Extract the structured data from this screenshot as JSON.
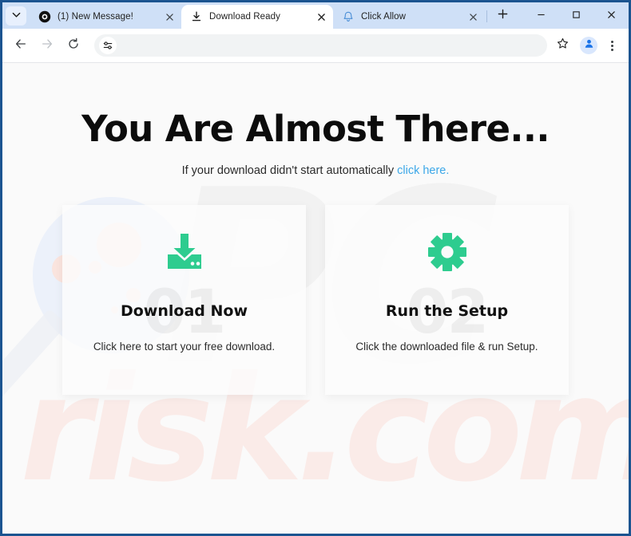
{
  "browser": {
    "tab_search_icon": "chevron-down-icon",
    "tabs": [
      {
        "title": "(1) New Message!",
        "favicon": "black-circle-icon",
        "active": false,
        "close_label": "×"
      },
      {
        "title": "Download Ready",
        "favicon": "download-icon",
        "active": true,
        "close_label": "×"
      },
      {
        "title": "Click Allow",
        "favicon": "bell-icon",
        "active": false,
        "close_label": "×"
      }
    ],
    "new_tab_label": "+",
    "window_controls": {
      "minimize": "–",
      "maximize": "□",
      "close": "×"
    },
    "toolbar": {
      "back_icon": "arrow-left-icon",
      "forward_icon": "arrow-right-icon",
      "reload_icon": "reload-icon",
      "omnibox_icon": "tune-icon",
      "omnibox_value": "",
      "omnibox_placeholder": "",
      "bookmark_icon": "star-icon",
      "profile_icon": "account-avatar-icon",
      "menu_icon": "three-dot-menu-icon"
    }
  },
  "page": {
    "headline": "You Are Almost There...",
    "subline_text": "If your download didn't start automatically ",
    "subline_link": "click here.",
    "watermarks": {
      "brand_primary": "PC",
      "brand_secondary": "risk.com"
    },
    "cards": [
      {
        "number": "01",
        "icon": "download-tray-icon",
        "title": "Download Now",
        "description": "Click here to start your free download."
      },
      {
        "number": "02",
        "icon": "gear-icon",
        "title": "Run the Setup",
        "description": "Click the downloaded file & run Setup."
      }
    ]
  },
  "colors": {
    "accent_green": "#2ecc8f",
    "link_blue": "#3ba7e8",
    "tabstrip_blue": "#cfe0f7",
    "window_border": "#1b5490",
    "watermark_pink": "#ffb9a6"
  }
}
